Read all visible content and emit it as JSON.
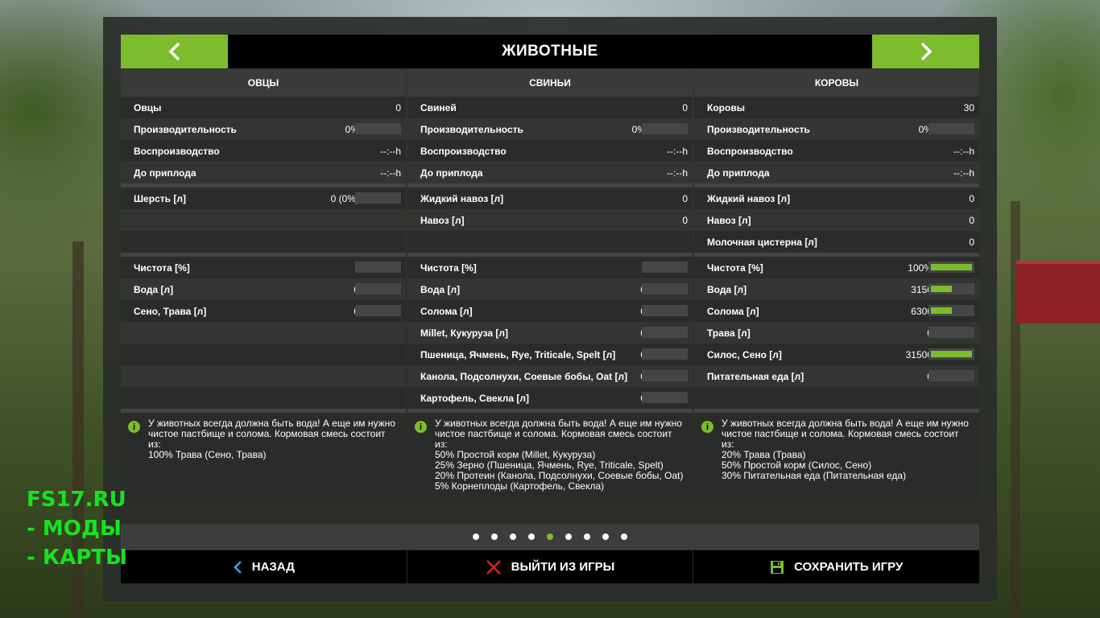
{
  "header": {
    "title": "ЖИВОТНЫЕ"
  },
  "columns": [
    {
      "title": "ОВЦЫ",
      "stats": [
        {
          "label": "Овцы",
          "value": "0"
        },
        {
          "label": "Производительность",
          "value": "0%",
          "bar": 0
        },
        {
          "label": "Воспроизводство",
          "value": "--:--h"
        },
        {
          "label": "До приплода",
          "value": "--:--h"
        }
      ],
      "products": [
        {
          "label": "Шерсть [л]",
          "value": "0 (0%)",
          "bar": 0
        },
        {
          "label": "",
          "value": ""
        },
        {
          "label": "",
          "value": ""
        }
      ],
      "resources": [
        {
          "label": "Чистота [%]",
          "value": "-",
          "bar": 0
        },
        {
          "label": "Вода [л]",
          "value": "0",
          "bar": 0
        },
        {
          "label": "Сено, Трава [л]",
          "value": "0",
          "bar": 0
        },
        {
          "label": "",
          "value": ""
        },
        {
          "label": "",
          "value": ""
        },
        {
          "label": "",
          "value": ""
        },
        {
          "label": "",
          "value": ""
        }
      ],
      "info": [
        "У животных всегда должна быть вода! А еще им нужно",
        "чистое пастбище и солома. Кормовая смесь состоит",
        "из:",
        "100% Трава (Сено, Трава)"
      ]
    },
    {
      "title": "СВИНЬИ",
      "stats": [
        {
          "label": "Свиней",
          "value": "0"
        },
        {
          "label": "Производительность",
          "value": "0%",
          "bar": 0
        },
        {
          "label": "Воспроизводство",
          "value": "--:--h"
        },
        {
          "label": "До приплода",
          "value": "--:--h"
        }
      ],
      "products": [
        {
          "label": "Жидкий навоз [л]",
          "value": "0"
        },
        {
          "label": "Навоз [л]",
          "value": "0"
        },
        {
          "label": "",
          "value": ""
        }
      ],
      "resources": [
        {
          "label": "Чистота [%]",
          "value": "-",
          "bar": 0
        },
        {
          "label": "Вода [л]",
          "value": "0",
          "bar": 0
        },
        {
          "label": "Солома [л]",
          "value": "0",
          "bar": 0
        },
        {
          "label": "Millet, Кукуруза [л]",
          "value": "0",
          "bar": 0
        },
        {
          "label": "Пшеница, Ячмень, Rye, Triticale, Spelt [л]",
          "value": "0",
          "bar": 0
        },
        {
          "label": "Канола, Подсолнухи, Соевые бобы, Oat [л]",
          "value": "0",
          "bar": 0
        },
        {
          "label": "Картофель, Свекла [л]",
          "value": "0",
          "bar": 0
        }
      ],
      "info": [
        "У животных всегда должна быть вода! А еще им нужно",
        "чистое пастбище и солома. Кормовая смесь состоит",
        "из:",
        "50% Простой корм (Millet, Кукуруза)",
        "25% Зерно (Пшеница, Ячмень, Rye, Triticale, Spelt)",
        "20% Протеин (Канола, Подсолнухи, Соевые бобы, Oat)",
        "5% Корнеплоды (Картофель, Свекла)"
      ]
    },
    {
      "title": "КОРОВЫ",
      "stats": [
        {
          "label": "Коровы",
          "value": "30"
        },
        {
          "label": "Производительность",
          "value": "0%",
          "bar": 0
        },
        {
          "label": "Воспроизводство",
          "value": "--:--h"
        },
        {
          "label": "До приплода",
          "value": "--:--h"
        }
      ],
      "products": [
        {
          "label": "Жидкий навоз [л]",
          "value": "0"
        },
        {
          "label": "Навоз [л]",
          "value": "0"
        },
        {
          "label": "Молочная цистерна [л]",
          "value": "0"
        }
      ],
      "resources": [
        {
          "label": "Чистота [%]",
          "value": "100%",
          "bar": 1.0
        },
        {
          "label": "Вода [л]",
          "value": "3150",
          "bar": 0.5
        },
        {
          "label": "Солома [л]",
          "value": "6300",
          "bar": 0.5
        },
        {
          "label": "Трава [л]",
          "value": "0",
          "bar": 0
        },
        {
          "label": "Силос, Сено [л]",
          "value": "31500",
          "bar": 1.0
        },
        {
          "label": "Питательная еда [л]",
          "value": "0",
          "bar": 0
        },
        {
          "label": "",
          "value": ""
        }
      ],
      "info": [
        "У животных всегда должна быть вода! А еще им нужно",
        "чистое пастбище и солома. Кормовая смесь состоит",
        "из:",
        "20% Трава (Трава)",
        "50% Простой корм (Силос, Сено)",
        "30% Питательная еда (Питательная еда)"
      ]
    }
  ],
  "pagination": {
    "count": 9,
    "active_index": 4
  },
  "footer": {
    "back_label": "НАЗАД",
    "quit_label": "ВЫЙТИ ИЗ ИГРЫ",
    "save_label": "СОХРАНИТЬ ИГРУ"
  },
  "watermark": {
    "line1": "FS17.RU",
    "line2": "- МОДЫ",
    "line3": "- КАРТЫ"
  },
  "colors": {
    "accent": "#7dbc2c",
    "back_icon": "#3aa0e8",
    "quit_icon": "#e01e1e"
  },
  "icons": {
    "prev": "chevron-left-icon",
    "next": "chevron-right-icon",
    "info": "info-icon",
    "back": "chevron-left-icon",
    "quit": "close-icon",
    "save": "floppy-disk-icon"
  }
}
